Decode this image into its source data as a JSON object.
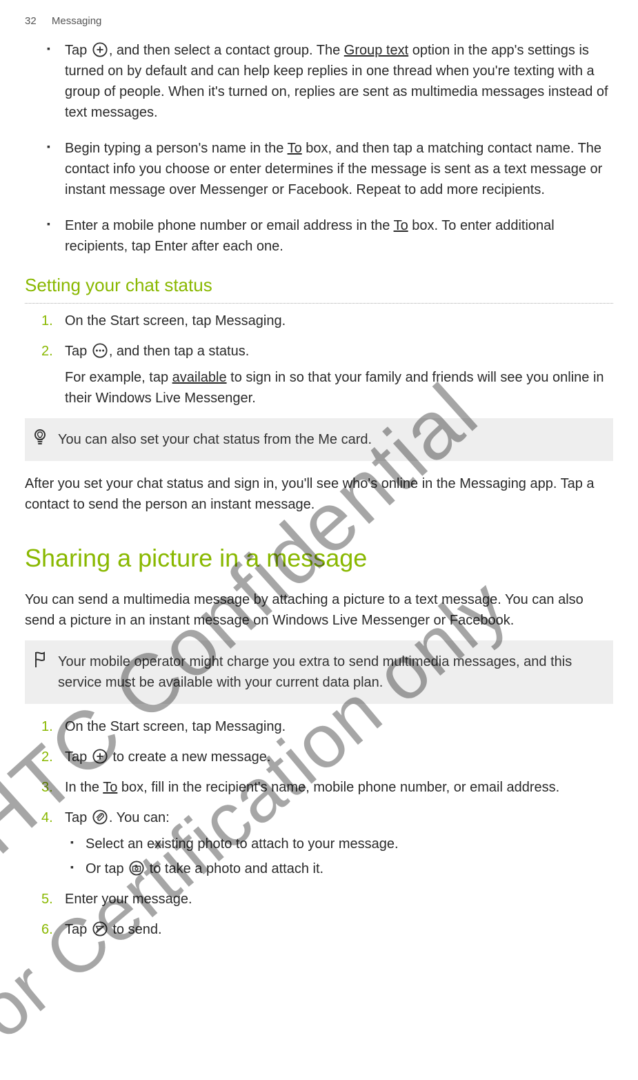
{
  "header": {
    "page_num": "32",
    "section": "Messaging"
  },
  "bullets_top": [
    {
      "pre": "Tap ",
      "icon": "plus",
      "post": ", and then select a contact group. The ",
      "u": "Group text",
      "tail": " option in the app's settings is turned on by default and can help keep replies in one thread when you're texting with a group of people. When it's turned on, replies are sent as multimedia messages instead of text messages."
    },
    {
      "pre": "Begin typing a person's name in the ",
      "u": "To",
      "tail": " box, and then tap a matching contact name. The contact info you choose or enter determines if the message is sent as a text message or instant message over Messenger or Facebook. Repeat to add more recipients."
    },
    {
      "pre": "Enter a mobile phone number or email address in the ",
      "u": "To",
      "tail": " box. To enter additional recipients, tap Enter after each one."
    }
  ],
  "section_chat_title": "Setting your chat status",
  "chat_steps": [
    {
      "text": "On the Start screen, tap Messaging."
    },
    {
      "pre": "Tap ",
      "icon": "dots",
      "post": ", and then tap a status.",
      "body_pre": "For example, tap ",
      "body_u": "available",
      "body_post": " to sign in so that your family and friends will see you online in their Windows Live Messenger."
    }
  ],
  "tip_callout": "You can also set your chat status from the Me card.",
  "chat_followup": "After you set your chat status and sign in, you'll see who's online in the Messaging app. Tap a contact to send the person an instant message.",
  "share_title": "Sharing a picture in a message",
  "share_intro": "You can send a multimedia message by attaching a picture to a text message. You can also send a picture in an instant message on Windows Live Messenger or Facebook.",
  "warn_callout": "Your mobile operator might charge you extra to send multimedia messages, and this service must be available with your current data plan.",
  "share_steps": [
    {
      "text": "On the Start screen, tap Messaging."
    },
    {
      "pre": "Tap ",
      "icon": "plus",
      "post": " to create a new message."
    },
    {
      "pre": "In the ",
      "u": "To",
      "tail": " box, fill in the recipient's name, mobile phone number, or email address."
    },
    {
      "pre": "Tap ",
      "icon": "attach",
      "post": ". You can:",
      "subs": [
        {
          "text": "Select an existing photo to attach to your message."
        },
        {
          "pre": "Or tap ",
          "icon": "camera",
          "post": " to take a photo and attach it."
        }
      ]
    },
    {
      "text": "Enter your message."
    },
    {
      "pre": "Tap ",
      "icon": "send",
      "post": " to send."
    }
  ],
  "watermarks": {
    "wm1": "HTC Confidential",
    "wm2": "for Certification only"
  }
}
